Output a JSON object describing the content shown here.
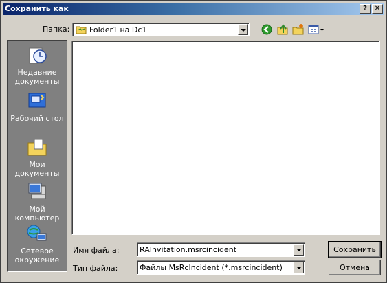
{
  "window": {
    "title": "Сохранить как",
    "help_label": "?",
    "close_label": "✕"
  },
  "toolbar": {
    "lookin_label": "Папка:",
    "lookin_value": "Folder1 на Dc1",
    "icons": [
      "back-icon",
      "up-folder-icon",
      "new-folder-icon",
      "view-menu-icon"
    ]
  },
  "places": [
    {
      "id": "recent",
      "label": "Недавние документы",
      "icon": "recent-documents-icon"
    },
    {
      "id": "desktop",
      "label": "Рабочий стол",
      "icon": "desktop-icon"
    },
    {
      "id": "mydocs",
      "label": "Мои документы",
      "icon": "my-documents-icon"
    },
    {
      "id": "mycomputer",
      "label": "Мой компьютер",
      "icon": "my-computer-icon"
    },
    {
      "id": "network",
      "label": "Сетевое окружение",
      "icon": "network-icon"
    }
  ],
  "form": {
    "filename_label": "Имя файла:",
    "filename_value": "RAInvitation.msrcincident",
    "filetype_label": "Тип файла:",
    "filetype_value": "Файлы MsRcIncident (*.msrcincident)"
  },
  "buttons": {
    "save": "Сохранить",
    "cancel": "Отмена"
  },
  "colors": {
    "titlebar_start": "#0a246a",
    "titlebar_end": "#a6caf0",
    "face": "#d4d0c8",
    "places_bg": "#808080"
  }
}
